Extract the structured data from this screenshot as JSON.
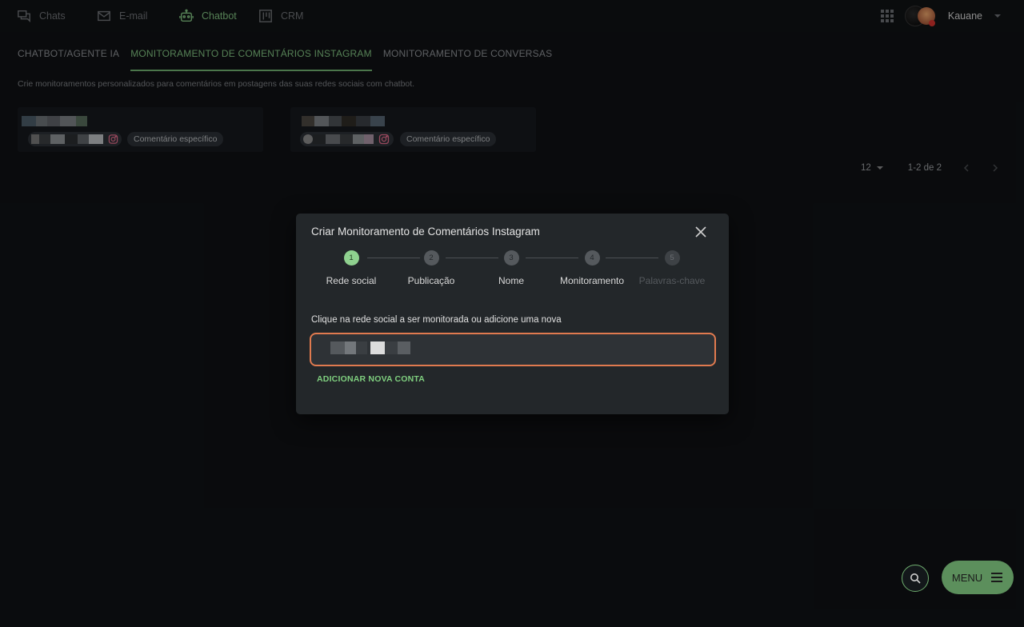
{
  "topnav": {
    "items": [
      {
        "label": "Chats",
        "icon": "chat-icon"
      },
      {
        "label": "E-mail",
        "icon": "mail-icon"
      },
      {
        "label": "Chatbot",
        "icon": "robot-icon"
      },
      {
        "label": "CRM",
        "icon": "kanban-icon"
      }
    ],
    "user_name": "Kauane",
    "active_color": "#7fbf7f"
  },
  "tabs": [
    {
      "label": "CHATBOT/AGENTE IA"
    },
    {
      "label": "MONITORAMENTO DE COMENTÁRIOS INSTAGRAM"
    },
    {
      "label": "MONITORAMENTO DE CONVERSAS"
    }
  ],
  "subtitle": "Crie monitoramentos personalizados para comentários em postagens das suas redes sociais com chatbot.",
  "cards": [
    {
      "type_label": "Comentário específico"
    },
    {
      "type_label": "Comentário específico"
    }
  ],
  "pagination": {
    "per_page": "12",
    "range": "1-2 de 2"
  },
  "dialog": {
    "title": "Criar Monitoramento de Comentários Instagram",
    "steps": [
      {
        "num": "1",
        "label": "Rede social"
      },
      {
        "num": "2",
        "label": "Publicação"
      },
      {
        "num": "3",
        "label": "Nome"
      },
      {
        "num": "4",
        "label": "Monitoramento"
      },
      {
        "num": "5",
        "label": "Palavras-chave"
      }
    ],
    "instruction": "Clique na rede social a ser monitorada ou adicione uma nova",
    "add_account_label": "ADICIONAR NOVA CONTA",
    "highlight_color": "#e07a4f"
  },
  "menu_label": "MENU"
}
